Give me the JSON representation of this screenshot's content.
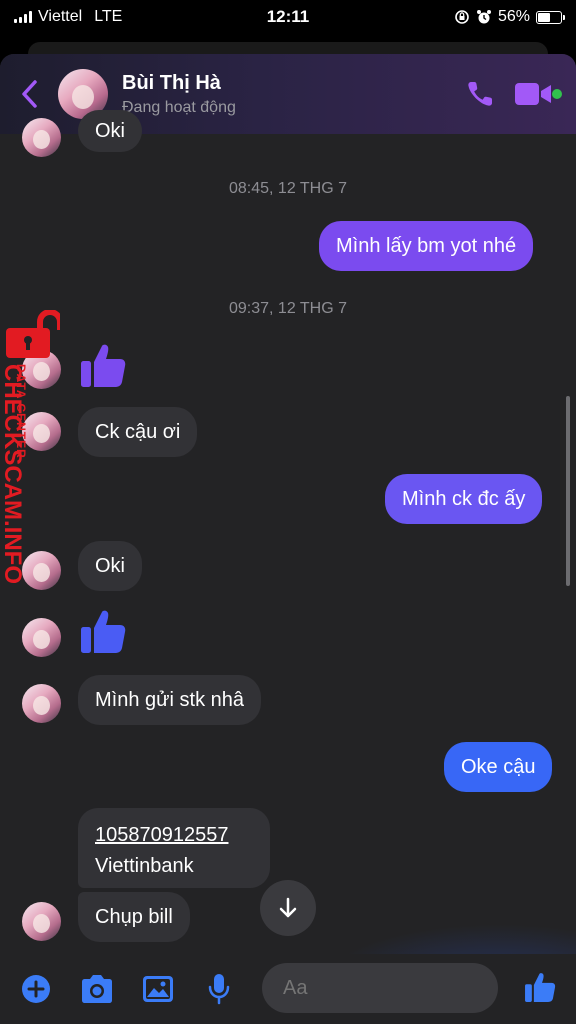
{
  "status_bar": {
    "carrier": "Viettel",
    "network": "LTE",
    "time": "12:11",
    "battery": "56%",
    "battery_level": 0.56
  },
  "header": {
    "contact_name": "Bùi Thị Hà",
    "contact_status": "Đang hoạt động",
    "icons": [
      "back-chevron-icon",
      "phone-icon",
      "video-camera-icon"
    ],
    "accent_color": "#a259f7"
  },
  "chat": {
    "partial_top_text": "Oki",
    "timestamps": [
      "08:45, 12 THG 7",
      "09:37, 12 THG 7"
    ],
    "messages": [
      {
        "side": "out",
        "text": "Mình lấy bm yot nhé"
      },
      {
        "side": "in",
        "type": "like"
      },
      {
        "side": "in",
        "text": "Ck cậu ơi"
      },
      {
        "side": "out",
        "text": "Mình ck đc ấy"
      },
      {
        "side": "in",
        "text": "Oki"
      },
      {
        "side": "in",
        "type": "like"
      },
      {
        "side": "in",
        "text": "Mình gửi stk nhâ"
      },
      {
        "side": "out",
        "text": "Oke cậu"
      },
      {
        "side": "in",
        "lines": [
          "105870912557",
          "Viettinbank"
        ]
      },
      {
        "side": "in",
        "text": "Chụp bill"
      }
    ]
  },
  "composer": {
    "placeholder": "Aa",
    "icons": [
      "plus-icon",
      "camera-icon",
      "image-icon",
      "microphone-icon",
      "emoji-icon",
      "like-icon"
    ]
  },
  "watermark": {
    "line1": "DATA CENTER",
    "line2": "CHECKSCAM.INFO"
  },
  "colors": {
    "bubble_in": "#323236",
    "bubble_out_purple": "#7b4bef",
    "bubble_out_blue": "#3867f6",
    "composer_icon": "#3b7cf7"
  }
}
